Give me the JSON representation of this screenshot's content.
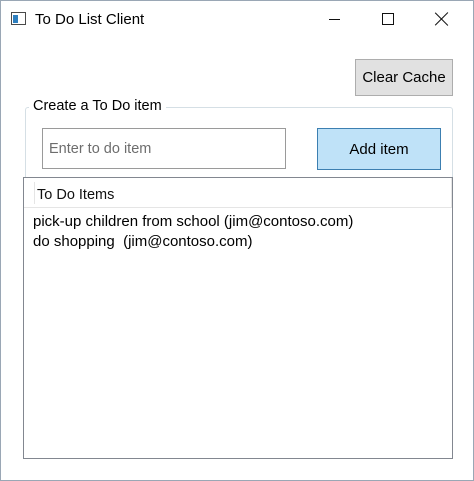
{
  "window": {
    "title": "To Do List Client"
  },
  "toolbar": {
    "clear_cache_label": "Clear Cache"
  },
  "create_group": {
    "label": "Create a To Do item",
    "input_placeholder": "Enter to do item",
    "input_value": "",
    "add_button_label": "Add item"
  },
  "list": {
    "column_header": "To Do Items",
    "items": [
      "pick-up children from school (jim@contoso.com)",
      "do shopping  (jim@contoso.com)"
    ]
  },
  "colors": {
    "add_button_bg": "#bfe2f8",
    "add_button_border": "#3c7fb1",
    "clear_button_bg": "#e1e1e1"
  }
}
